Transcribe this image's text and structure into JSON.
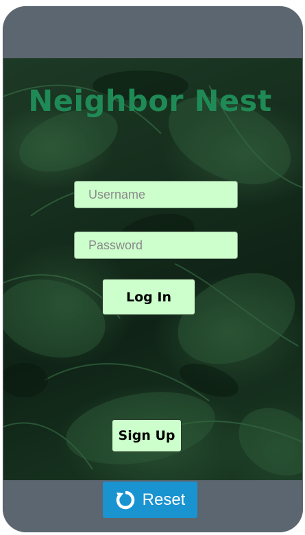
{
  "app": {
    "title": "Neighbor Nest"
  },
  "login_form": {
    "username_placeholder": "Username",
    "password_placeholder": "Password",
    "login_label": "Log In",
    "signup_label": "Sign Up"
  },
  "footer": {
    "reset_label": "Reset",
    "reset_icon": "refresh-icon"
  },
  "colors": {
    "frame": "#5c6670",
    "title": "#1f8a55",
    "field_background": "#ccffcc",
    "reset_button": "#1a93d1"
  }
}
